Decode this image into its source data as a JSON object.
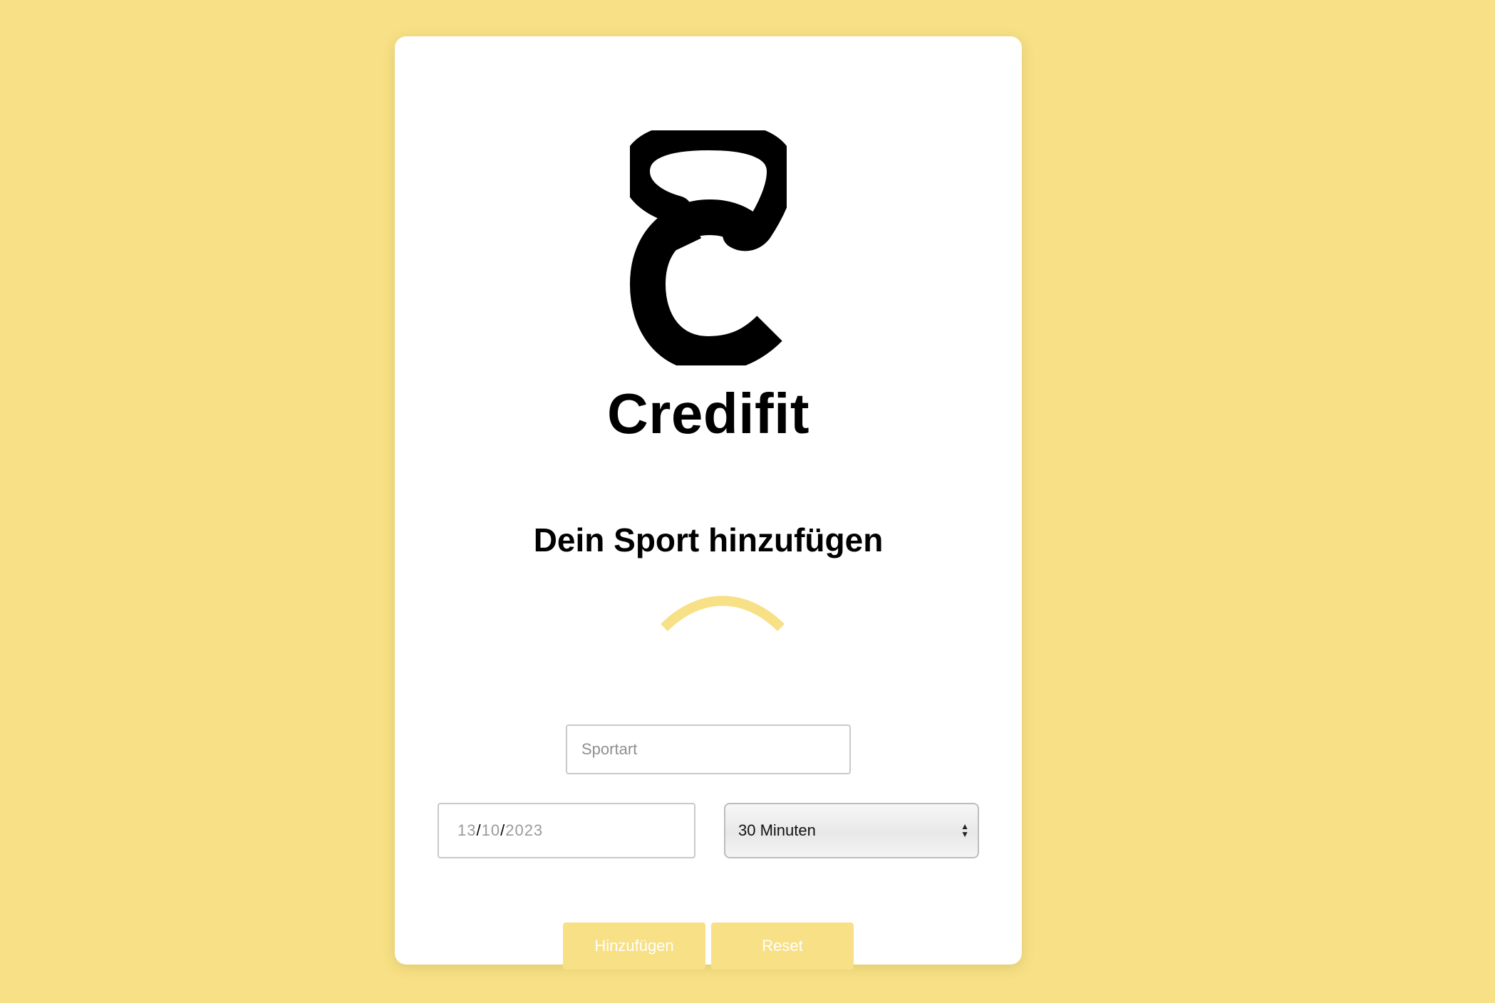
{
  "colors": {
    "background": "#f7e085",
    "card": "#ffffff",
    "accent": "#f7e085",
    "text": "#000000"
  },
  "brand": {
    "name": "Credifit",
    "logo_icon": "kettlebell-c-logo-icon"
  },
  "form": {
    "title": "Dein Sport hinzufügen",
    "loading_icon": "loading-spinner-icon",
    "sport": {
      "placeholder": "Sportart",
      "value": ""
    },
    "date": {
      "day": "13",
      "month": "10",
      "year": "2023",
      "separator": "/"
    },
    "duration": {
      "selected": "30 Minuten"
    },
    "buttons": {
      "add_label": "Hinzufügen",
      "reset_label": "Reset"
    }
  }
}
